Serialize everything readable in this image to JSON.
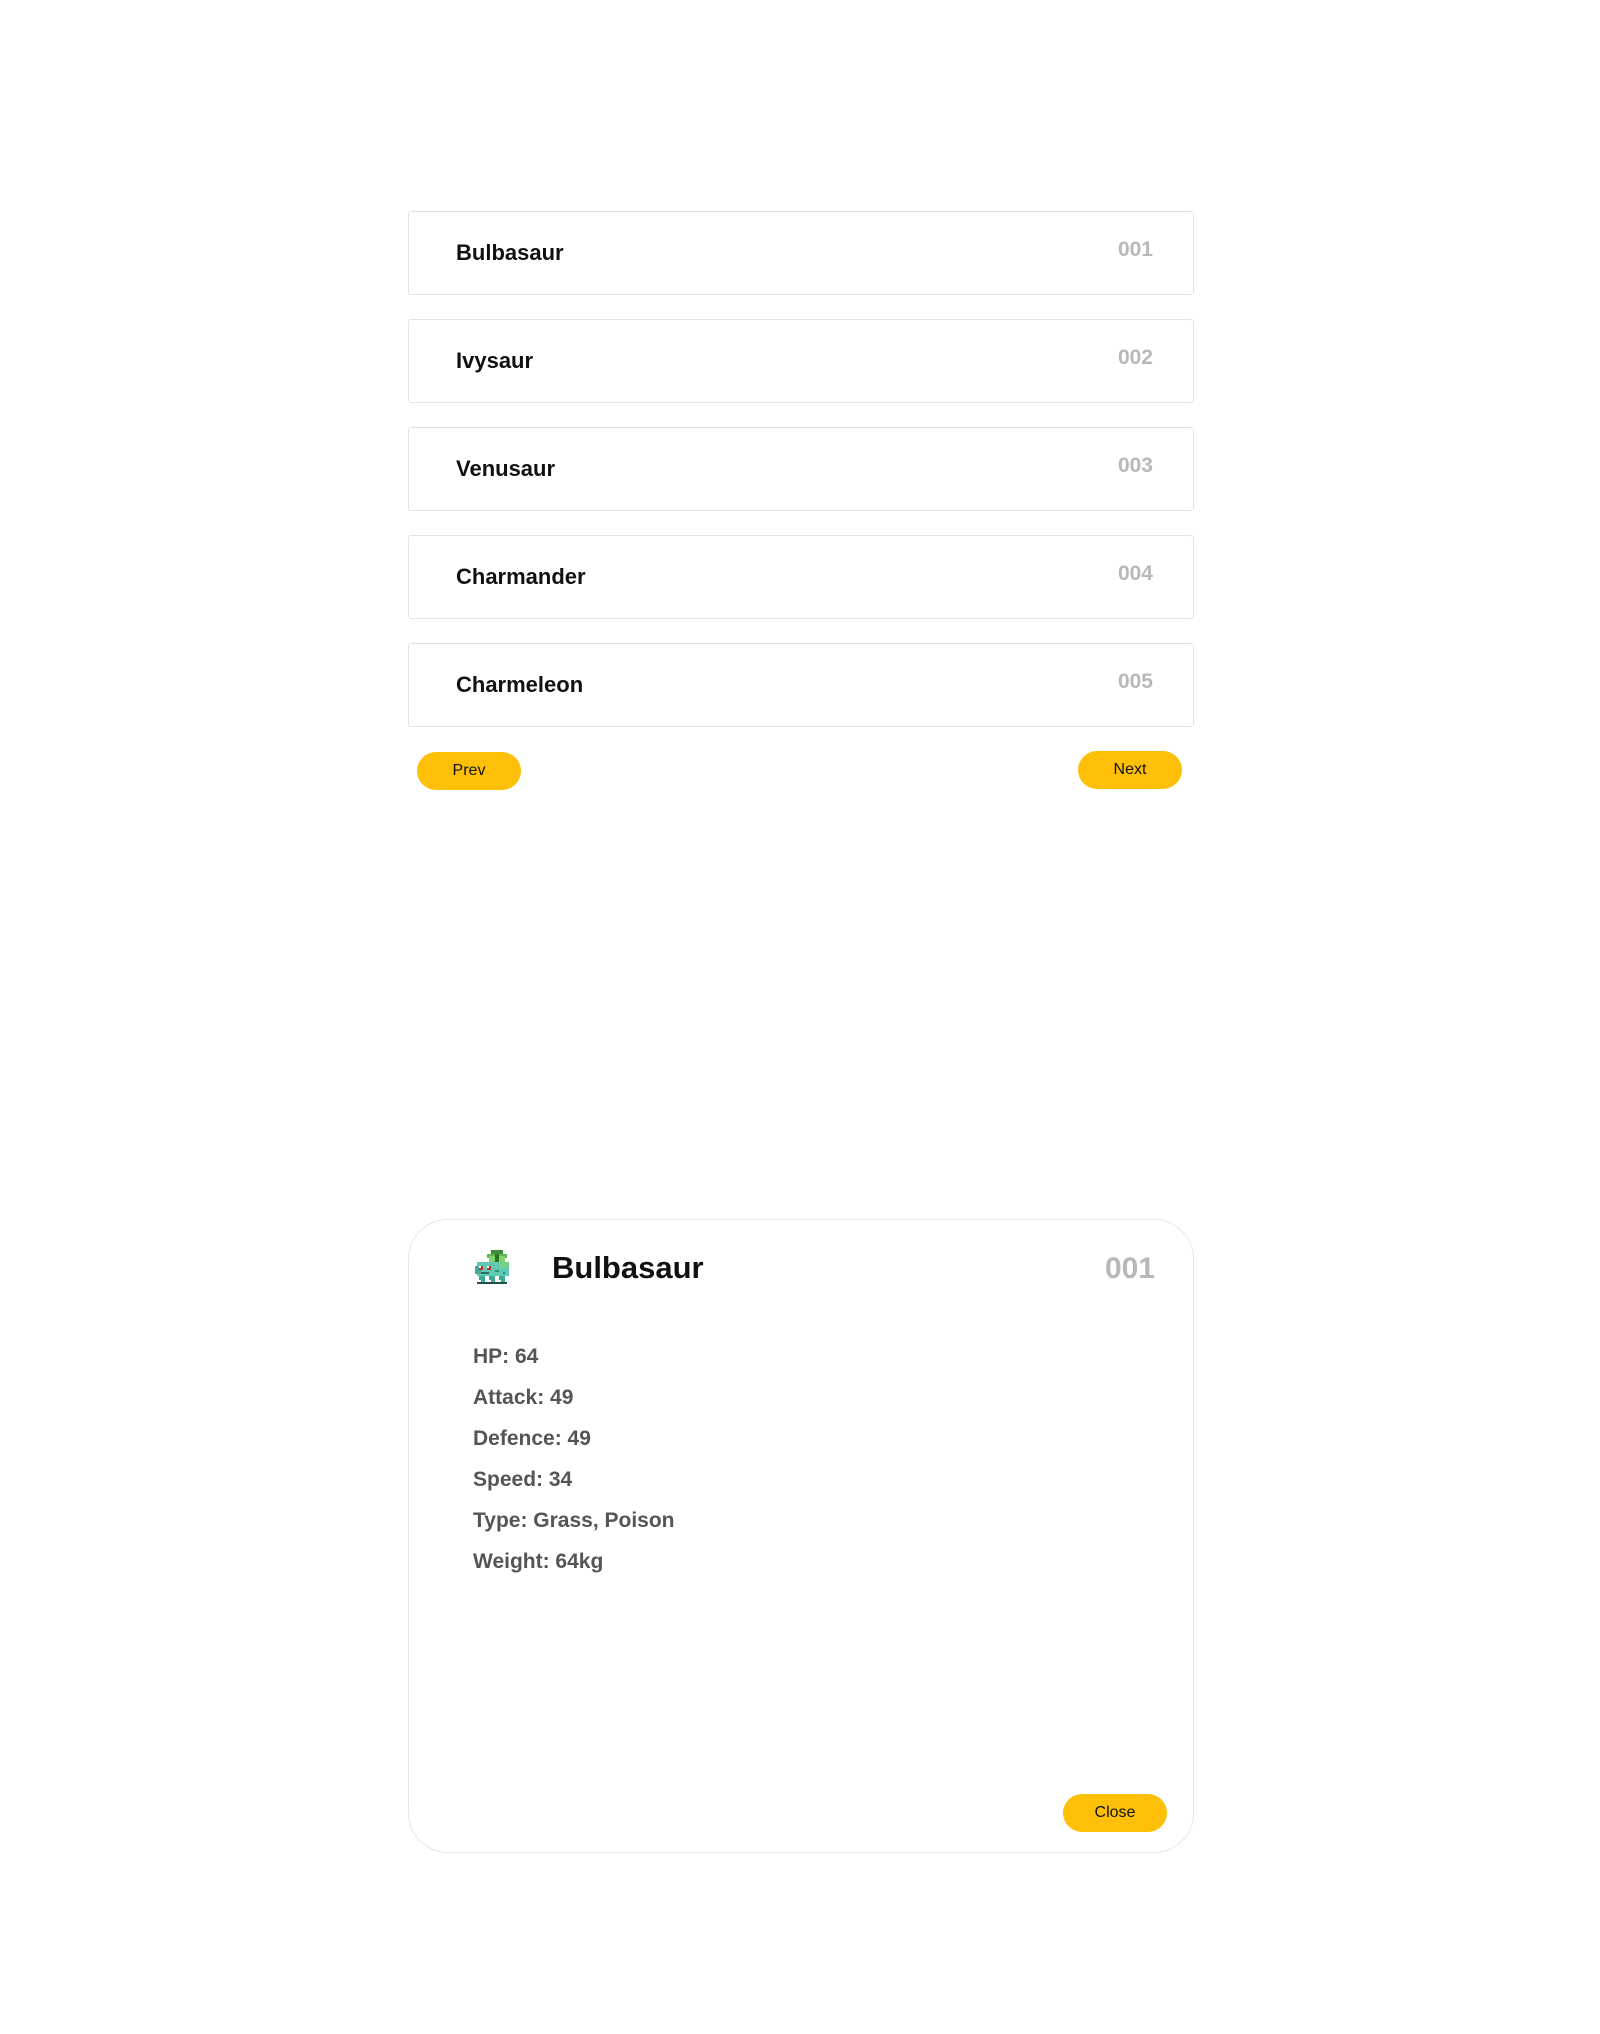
{
  "pokemon_list": [
    {
      "name": "Bulbasaur",
      "number": "001"
    },
    {
      "name": "Ivysaur",
      "number": "002"
    },
    {
      "name": "Venusaur",
      "number": "003"
    },
    {
      "name": "Charmander",
      "number": "004"
    },
    {
      "name": "Charmeleon",
      "number": "005"
    }
  ],
  "pagination": {
    "prev_label": "Prev",
    "next_label": "Next"
  },
  "detail": {
    "sprite_icon": "bulbasaur-sprite-icon",
    "name": "Bulbasaur",
    "number": "001",
    "stats": [
      "HP: 64",
      "Attack: 49",
      "Defence: 49",
      "Speed: 34",
      "Type: Grass, Poison",
      "Weight: 64kg"
    ],
    "close_label": "Close"
  },
  "colors": {
    "accent": "#fdbf07",
    "number_gray": "#b8b8b8",
    "stat_text": "#555555",
    "border": "#e4e4e4"
  }
}
